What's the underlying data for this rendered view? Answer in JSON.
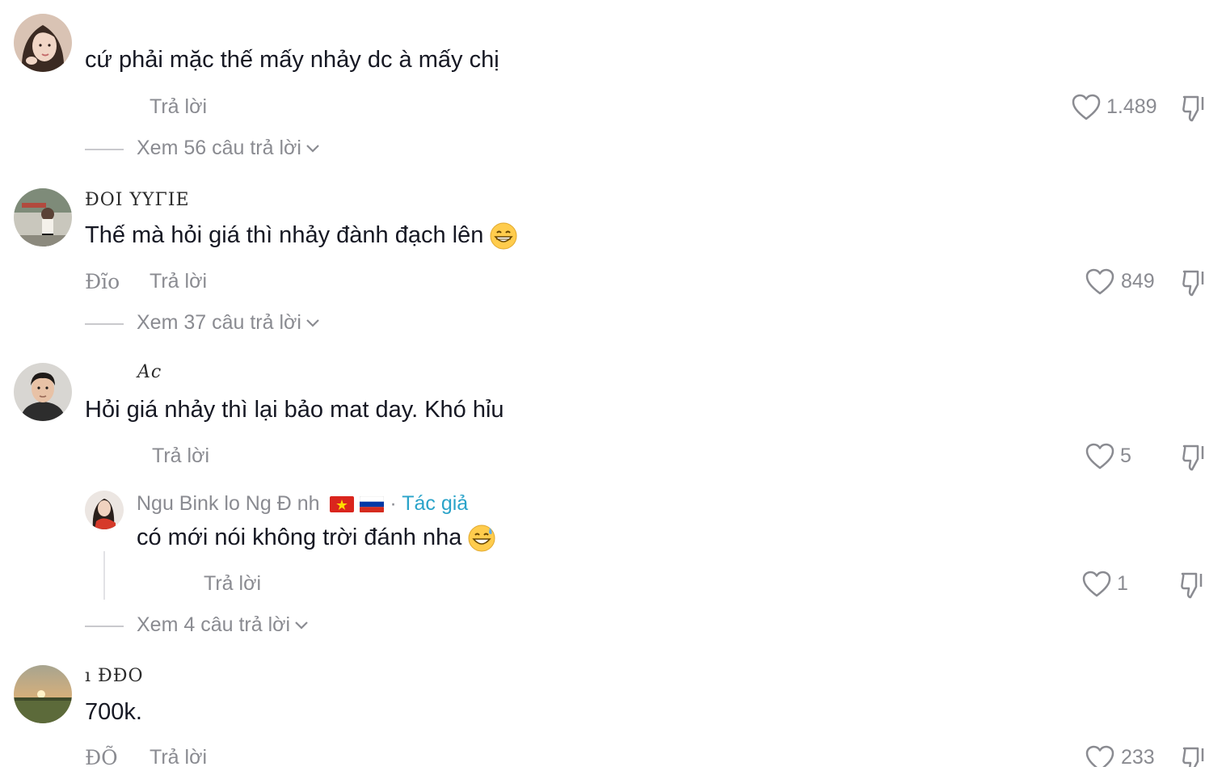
{
  "comments": [
    {
      "username": "",
      "text": "cứ phải mặc thế mấy nhảy dc à mấy chị",
      "meta": "",
      "reply_label": "Trả lời",
      "likes": "1.489",
      "view_replies": "Xem 56 câu trả lời"
    },
    {
      "username": "ĐOI ΥΥΓΙΕ",
      "text": "Thế mà hỏi giá thì nhảy đành đạch lên",
      "meta": "Đĩo",
      "reply_label": "Trả lời",
      "likes": "849",
      "view_replies": "Xem 37 câu trả lời"
    },
    {
      "username": "Ac",
      "text": "Hỏi giá nhảy thì lại bảo mat day. Khó hỉu",
      "meta": "",
      "reply_label": "Trả lời",
      "likes": "5",
      "view_replies": "Xem 4 câu trả lời",
      "reply": {
        "username": "Ngu Bink lo Ng Đ nh",
        "author_badge": "Tác giả",
        "text": "có mới nói không trời đánh nha",
        "reply_label": "Trả lời",
        "likes": "1"
      }
    },
    {
      "username": "ı ĐĐO",
      "text": "700k.",
      "meta": "ĐÕ",
      "reply_label": "Trả lời",
      "likes": "233"
    }
  ],
  "colors": {
    "text": "#161823",
    "muted": "#8a8b91",
    "author": "#2aa3c9"
  }
}
